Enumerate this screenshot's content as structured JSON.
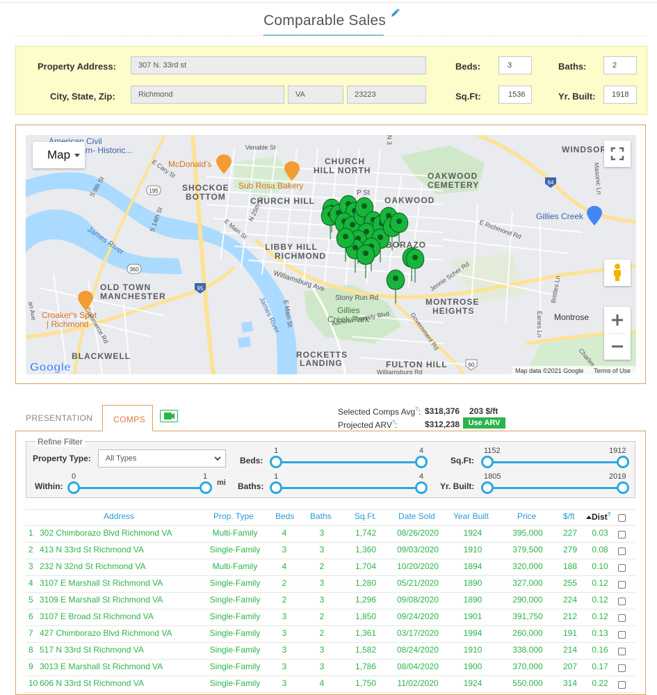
{
  "header": {
    "title": "Comparable Sales"
  },
  "property": {
    "address_label": "Property Address:",
    "address": "307 N. 33rd st",
    "csz_label": "City, State, Zip:",
    "city": "Richmond",
    "state": "VA",
    "zip": "23223",
    "beds_label": "Beds:",
    "beds": "3",
    "baths_label": "Baths:",
    "baths": "2",
    "sqft_label": "Sq.Ft:",
    "sqft": "1536",
    "yr_label": "Yr. Built:",
    "yr_built": "1918"
  },
  "map": {
    "type_button": "Map",
    "attribution": "Map data ©2021 Google",
    "terms": "Terms of Use",
    "logo": "Google",
    "labels": {
      "american_civil": "American Civil",
      "museum": "Museum- Historic...",
      "venable": "Venable St",
      "mcdonalds": "McDonald's",
      "e_cary": "E Cary St",
      "s9th": "S 9th St",
      "r195": "195",
      "shockoe": "SHOCKOE",
      "bottom": "BOTTOM",
      "sub_rosa": "Sub Rosa Bakery",
      "church_hill_north1": "CHURCH",
      "church_hill_north2": "HILL NORTH",
      "church_hill": "CHURCH HILL",
      "p_st": "P St",
      "oakwood_cem1": "OAKWOOD",
      "oakwood_cem2": "CEMETERY",
      "oakwood": "OAKWOOD",
      "windsor": "WINDSOR",
      "masonic": "Masonic Ln",
      "e_richmond_rd": "E Richmond Rd",
      "gillies_creek": "Gillies Creek",
      "r64": "64",
      "james_river": "James River",
      "s14th": "S 14th St",
      "e_main": "E Main St",
      "n25th": "N 25th St",
      "libby1": "LIBBY HILL",
      "libby2": "RICHMOND",
      "chimborazo": "BORAZO",
      "r360": "360",
      "r95": "95",
      "old_town1": "OLD TOWN",
      "old_town2": "MANCHESTER",
      "williamsburg": "Williamsburg Ave",
      "stony_run": "Stony Run Rd",
      "gillies_park1": "Gillies",
      "gillies_park2": "Creek Park",
      "jennie": "Jennie Scher Rd",
      "montrose_h1": "MONTROSE",
      "montrose_h2": "HEIGHTS",
      "montrose": "Montrose",
      "eanes": "Eanes Ln",
      "brittles": "Brittles Ln",
      "croakers1": "Croaker's Spot",
      "croakers2": "| Richmond",
      "commerce": "Commerce Rd",
      "james_river2": "James River",
      "e_main2": "E Main St",
      "admiral": "Admiral Gravely Blvd",
      "government": "Government Rd",
      "blackwell": "BLACKWELL",
      "rocketts1": "ROCKETTS",
      "rocketts2": "LANDING",
      "fulton": "FULTON HILL",
      "r60": "60",
      "williamsburg2": "Williamsburg Rd",
      "charles": "Charles",
      "n_ave": "an Ave",
      "n33": "N 3"
    }
  },
  "tabs": {
    "presentation": "PRESENTATION",
    "comps": "COMPS"
  },
  "summary": {
    "avg_label": "Selected Comps Avg",
    "avg_value": "$318,376",
    "avg_psf": "203 $/ft",
    "arv_label": "Projected ARV",
    "arv_value": "$312,238",
    "use_arv": "Use ARV",
    "help": "?"
  },
  "filter": {
    "legend": "Refine Filter",
    "property_type_label": "Property Type:",
    "property_type": "All Types",
    "within_label": "Within:",
    "within_min": "0",
    "within_max": "1",
    "within_unit": "mi",
    "beds_label": "Beds:",
    "beds_min": "1",
    "beds_max": "4",
    "baths_label": "Baths:",
    "baths_min": "1",
    "baths_max": "4",
    "sqft_label": "Sq.Ft:",
    "sqft_min": "1152",
    "sqft_max": "1912",
    "yr_label": "Yr. Built:",
    "yr_min": "1805",
    "yr_max": "2019"
  },
  "table": {
    "columns": [
      "Address",
      "Prop. Type",
      "Beds",
      "Baths",
      "Sq.Ft.",
      "Date Sold",
      "Year Built",
      "Price",
      "$/ft",
      "Dist"
    ],
    "sort_help": "?",
    "rows": [
      {
        "n": "1",
        "address": "302 Chimborazo Blvd Richmond VA",
        "type": "Multi-Family",
        "beds": "4",
        "baths": "3",
        "sqft": "1,742",
        "date": "08/26/2020",
        "year": "1924",
        "price": "395,000",
        "psf": "227",
        "dist": "0.03"
      },
      {
        "n": "2",
        "address": "413 N 33rd St Richmond VA",
        "type": "Single-Family",
        "beds": "3",
        "baths": "3",
        "sqft": "1,360",
        "date": "09/03/2020",
        "year": "1910",
        "price": "379,500",
        "psf": "279",
        "dist": "0.08"
      },
      {
        "n": "3",
        "address": "232 N 32nd St Richmond VA",
        "type": "Multi-Family",
        "beds": "4",
        "baths": "2",
        "sqft": "1,704",
        "date": "10/20/2020",
        "year": "1894",
        "price": "320,000",
        "psf": "188",
        "dist": "0.10"
      },
      {
        "n": "4",
        "address": "3107 E Marshall St Richmond VA",
        "type": "Single-Family",
        "beds": "2",
        "baths": "3",
        "sqft": "1,280",
        "date": "05/21/2020",
        "year": "1890",
        "price": "327,000",
        "psf": "255",
        "dist": "0.12"
      },
      {
        "n": "5",
        "address": "3109 E Marshall St Richmond VA",
        "type": "Single-Family",
        "beds": "2",
        "baths": "3",
        "sqft": "1,296",
        "date": "09/08/2020",
        "year": "1890",
        "price": "290,000",
        "psf": "224",
        "dist": "0.12"
      },
      {
        "n": "6",
        "address": "3107 E Broad St Richmond VA",
        "type": "Single-Family",
        "beds": "3",
        "baths": "2",
        "sqft": "1,850",
        "date": "09/24/2020",
        "year": "1901",
        "price": "391,750",
        "psf": "212",
        "dist": "0.12"
      },
      {
        "n": "7",
        "address": "427 Chimborazo Blvd Richmond VA",
        "type": "Single-Family",
        "beds": "3",
        "baths": "2",
        "sqft": "1,361",
        "date": "03/17/2020",
        "year": "1994",
        "price": "260,000",
        "psf": "191",
        "dist": "0.13"
      },
      {
        "n": "8",
        "address": "517 N 33rd St Richmond VA",
        "type": "Single-Family",
        "beds": "3",
        "baths": "3",
        "sqft": "1,582",
        "date": "08/24/2020",
        "year": "1910",
        "price": "338,000",
        "psf": "214",
        "dist": "0.16"
      },
      {
        "n": "9",
        "address": "3013 E Marshall St Richmond VA",
        "type": "Single-Family",
        "beds": "3",
        "baths": "3",
        "sqft": "1,786",
        "date": "08/04/2020",
        "year": "1900",
        "price": "370,000",
        "psf": "207",
        "dist": "0.17"
      },
      {
        "n": "10",
        "address": "606 N 33rd St Richmond VA",
        "type": "Single-Family",
        "beds": "3",
        "baths": "4",
        "sqft": "1,750",
        "date": "11/02/2020",
        "year": "1924",
        "price": "550,000",
        "psf": "314",
        "dist": "0.22"
      }
    ]
  },
  "colors": {
    "accent": "#2a9aa8",
    "green": "#2cb34a",
    "blue": "#2a9ad6",
    "orange": "#e0773a",
    "panel": "#fdfccb",
    "frame": "#d9a15a",
    "slider": "#2aa9df"
  }
}
